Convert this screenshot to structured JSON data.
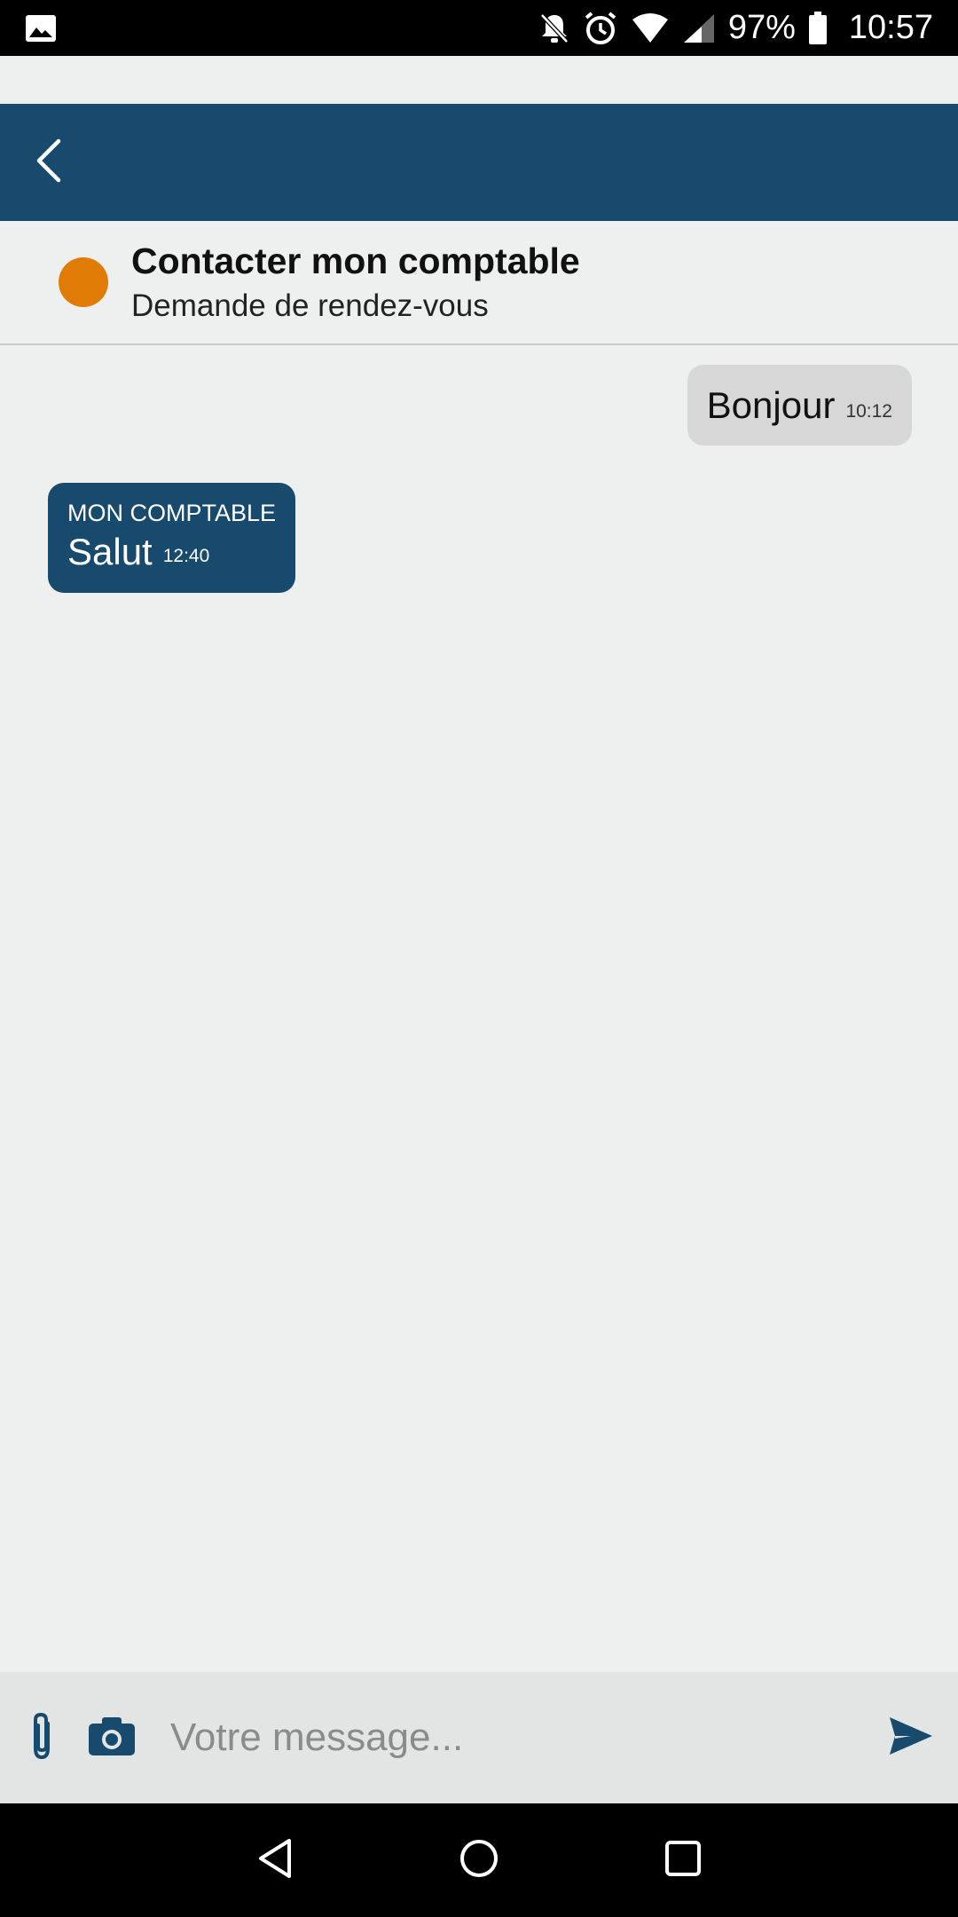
{
  "status_bar": {
    "battery": "97%",
    "time": "10:57",
    "icons": [
      "image-icon",
      "bell-off-icon",
      "alarm-icon",
      "wifi-icon",
      "signal-icon",
      "battery-icon"
    ]
  },
  "conversation": {
    "title": "Contacter mon comptable",
    "subtitle": "Demande de rendez-vous",
    "status_color": "#e07b06"
  },
  "messages": [
    {
      "direction": "outgoing",
      "text": "Bonjour",
      "time": "10:12"
    },
    {
      "direction": "incoming",
      "sender": "MON COMPTABLE",
      "text": "Salut",
      "time": "12:40"
    }
  ],
  "composer": {
    "placeholder": "Votre message...",
    "value": ""
  },
  "colors": {
    "primary": "#174a6d",
    "accent": "#e07b06",
    "background": "#eef0ef"
  }
}
